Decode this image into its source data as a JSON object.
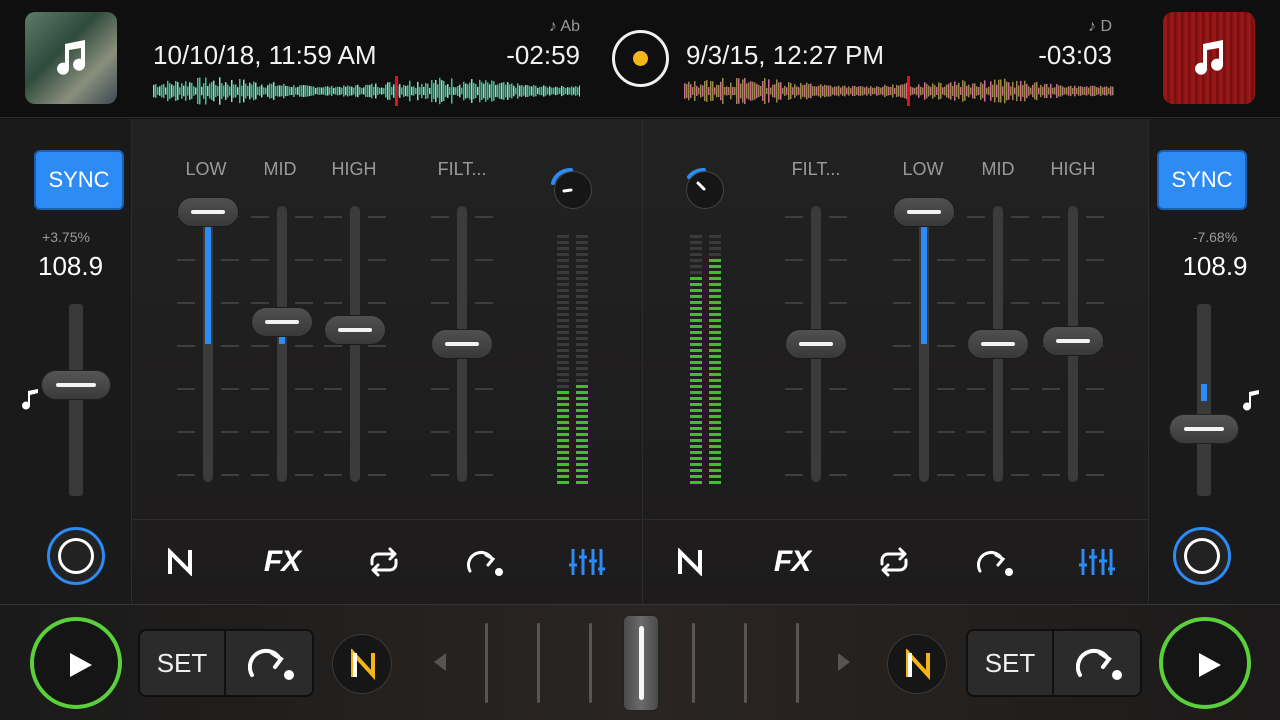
{
  "deck_a": {
    "date": "10/10/18, 11:59 AM",
    "time_remaining": "-02:59",
    "key": "♪ Ab",
    "sync_label": "SYNC",
    "pitch_percent": "+3.75%",
    "bpm": "108.9",
    "pitch_level": 0.42,
    "eq": {
      "low_label": "LOW",
      "mid_label": "MID",
      "high_label": "HIGH",
      "filter_label": "FILT...",
      "low": 0.98,
      "mid": 0.58,
      "high": 0.55,
      "filter": 0.5
    }
  },
  "deck_b": {
    "date": "9/3/15, 12:27 PM",
    "time_remaining": "-03:03",
    "key": "♪ D",
    "sync_label": "SYNC",
    "pitch_percent": "-7.68%",
    "bpm": "108.9",
    "pitch_level": 0.65,
    "eq": {
      "low_label": "LOW",
      "mid_label": "MID",
      "high_label": "HIGH",
      "filter_label": "FILT...",
      "low": 0.98,
      "mid": 0.5,
      "high": 0.51,
      "filter": 0.5
    }
  },
  "fxbar": [
    "n-logo-icon",
    "fx-icon",
    "loop-icon",
    "cue-jump-icon",
    "mixer-sliders-icon"
  ],
  "fx_label": "FX",
  "transport": {
    "set_label": "SET",
    "crossfader_position": 0.5
  },
  "colors": {
    "accent": "#2d8bf5",
    "play_ring": "#5ad13b",
    "logo_dot": "#f3b51a",
    "meter": "#3fbf2f"
  }
}
